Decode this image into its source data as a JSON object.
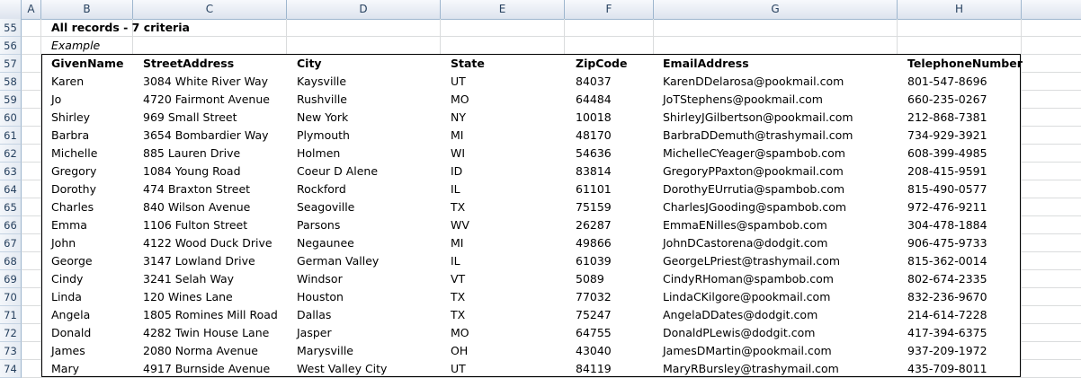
{
  "columns": [
    "A",
    "B",
    "C",
    "D",
    "E",
    "F",
    "G",
    "H"
  ],
  "row_numbers": [
    "55",
    "56",
    "57",
    "58",
    "59",
    "60",
    "61",
    "62",
    "63",
    "64",
    "65",
    "66",
    "67",
    "68",
    "69",
    "70",
    "71",
    "72",
    "73",
    "74"
  ],
  "title": "All records - 7 criteria",
  "subtitle": "Example",
  "headers": [
    "GivenName",
    "StreetAddress",
    "City",
    "State",
    "ZipCode",
    "EmailAddress",
    "TelephoneNumber"
  ],
  "records": [
    [
      "Karen",
      "3084 White River Way",
      "Kaysville",
      "UT",
      "84037",
      "KarenDDelarosa@pookmail.com",
      "801-547-8696"
    ],
    [
      "Jo",
      "4720 Fairmont Avenue",
      "Rushville",
      "MO",
      "64484",
      "JoTStephens@pookmail.com",
      "660-235-0267"
    ],
    [
      "Shirley",
      "969 Small Street",
      "New York",
      "NY",
      "10018",
      "ShirleyJGilbertson@pookmail.com",
      "212-868-7381"
    ],
    [
      "Barbra",
      "3654 Bombardier Way",
      "Plymouth",
      "MI",
      "48170",
      "BarbraDDemuth@trashymail.com",
      "734-929-3921"
    ],
    [
      "Michelle",
      "885 Lauren Drive",
      "Holmen",
      "WI",
      "54636",
      "MichelleCYeager@spambob.com",
      "608-399-4985"
    ],
    [
      "Gregory",
      "1084 Young Road",
      "Coeur D Alene",
      "ID",
      "83814",
      "GregoryPPaxton@pookmail.com",
      "208-415-9591"
    ],
    [
      "Dorothy",
      "474 Braxton Street",
      "Rockford",
      "IL",
      "61101",
      "DorothyEUrrutia@spambob.com",
      "815-490-0577"
    ],
    [
      "Charles",
      "840 Wilson Avenue",
      "Seagoville",
      "TX",
      "75159",
      "CharlesJGooding@spambob.com",
      "972-476-9211"
    ],
    [
      "Emma",
      "1106 Fulton Street",
      "Parsons",
      "WV",
      "26287",
      "EmmaENilles@spambob.com",
      "304-478-1884"
    ],
    [
      "John",
      "4122 Wood Duck Drive",
      "Negaunee",
      "MI",
      "49866",
      "JohnDCastorena@dodgit.com",
      "906-475-9733"
    ],
    [
      "George",
      "3147 Lowland Drive",
      "German Valley",
      "IL",
      "61039",
      "GeorgeLPriest@trashymail.com",
      "815-362-0014"
    ],
    [
      "Cindy",
      "3241 Selah Way",
      "Windsor",
      "VT",
      "5089",
      "CindyRHoman@spambob.com",
      "802-674-2335"
    ],
    [
      "Linda",
      "120 Wines Lane",
      "Houston",
      "TX",
      "77032",
      "LindaCKilgore@pookmail.com",
      "832-236-9670"
    ],
    [
      "Angela",
      "1805 Romines Mill Road",
      "Dallas",
      "TX",
      "75247",
      "AngelaDDates@dodgit.com",
      "214-614-7228"
    ],
    [
      "Donald",
      "4282 Twin House Lane",
      "Jasper",
      "MO",
      "64755",
      "DonaldPLewis@dodgit.com",
      "417-394-6375"
    ],
    [
      "James",
      "2080 Norma Avenue",
      "Marysville",
      "OH",
      "43040",
      "JamesDMartin@pookmail.com",
      "937-209-1972"
    ],
    [
      "Mary",
      "4917 Burnside Avenue",
      "West Valley City",
      "UT",
      "84119",
      "MaryRBursley@trashymail.com",
      "435-709-8011"
    ]
  ]
}
